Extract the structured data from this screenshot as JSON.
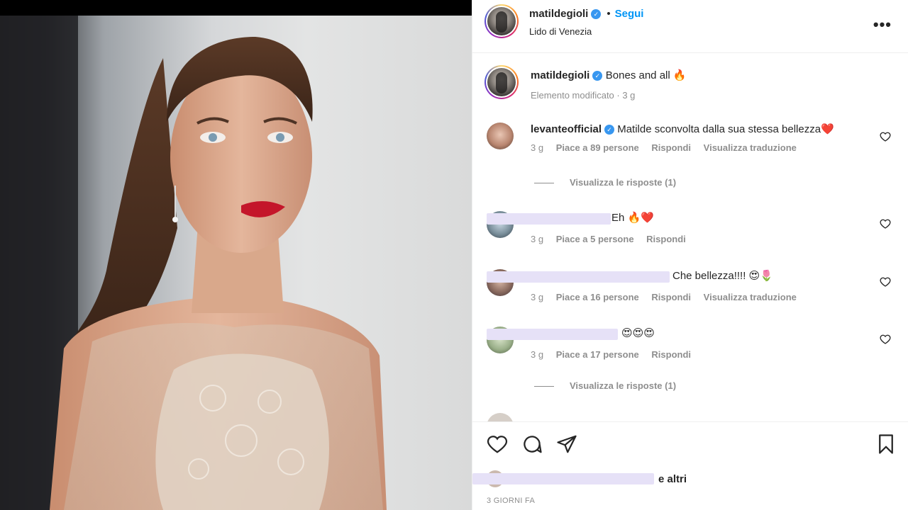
{
  "post": {
    "username": "matildegioli",
    "verified_mark": "✓",
    "separator": "•",
    "follow_label": "Segui",
    "location": "Lido di Venezia",
    "more_icon": "•••"
  },
  "caption": {
    "username": "matildegioli",
    "text": "Bones and all 🔥",
    "meta": "Elemento modificato · 3 g"
  },
  "comments": [
    {
      "username": "levanteofficial",
      "text": "Matilde sconvolta dalla sua stessa bellezza❤️",
      "time": "3 g",
      "likes": "Piace a 89 persone",
      "reply": "Rispondi",
      "translate": "Visualizza traduzione",
      "replies": "Visualizza le risposte (1)"
    },
    {
      "text": "Eh 🔥❤️",
      "time": "3 g",
      "likes": "Piace a 5 persone",
      "reply": "Rispondi"
    },
    {
      "text": "Che bellezza!!!! 😍🌷",
      "time": "3 g",
      "likes": "Piace a 16 persone",
      "reply": "Rispondi",
      "translate": "Visualizza traduzione"
    },
    {
      "text": "😍😍😍",
      "time": "3 g",
      "likes": "Piace a 17 persone",
      "reply": "Rispondi",
      "replies": "Visualizza le risposte (1)"
    }
  ],
  "footer": {
    "likes_suffix": "e altri",
    "time_label": "3 GIORNI FA"
  },
  "icons": {
    "like": "heart-icon",
    "comment": "comment-icon",
    "share": "share-icon",
    "save": "bookmark-icon"
  },
  "colors": {
    "accent": "#0095f6",
    "verified": "#3897f0",
    "muted": "#8e8e8e"
  }
}
